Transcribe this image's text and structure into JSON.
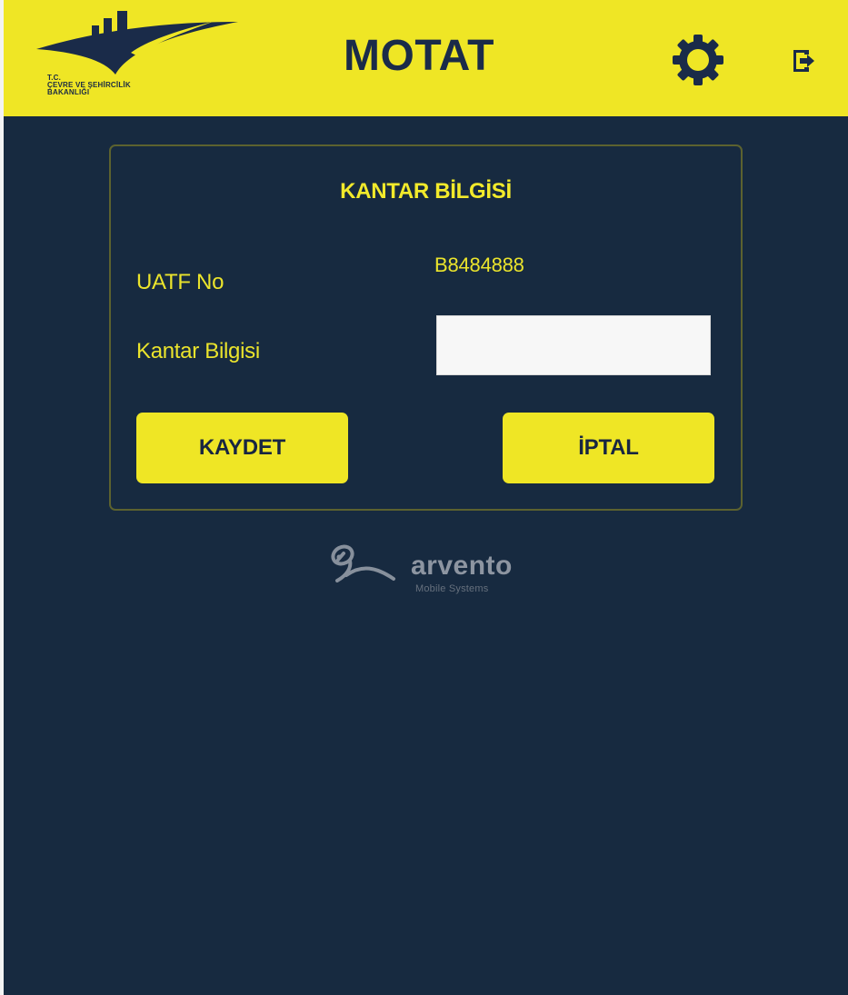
{
  "header": {
    "title": "MOTAT",
    "logo_text": [
      "T.C.",
      "ÇEVRE VE ŞEHİRCİLİK",
      "BAKANLIĞI"
    ],
    "settings_icon": "gear-icon",
    "logout_icon": "logout-icon"
  },
  "form": {
    "title": "KANTAR BİLGİSİ",
    "uatf_label": "UATF No",
    "uatf_value": "B8484888",
    "kantar_label": "Kantar Bilgisi",
    "kantar_value": "",
    "kantar_placeholder": ""
  },
  "actions": {
    "save_label": "KAYDET",
    "cancel_label": "İPTAL"
  },
  "footer": {
    "brand_name": "arvento",
    "brand_tagline": "Mobile Systems"
  },
  "colors": {
    "header_background": "#efe625",
    "page_background": "#172a40",
    "accent": "#ebe42c",
    "button_text": "#182641"
  }
}
